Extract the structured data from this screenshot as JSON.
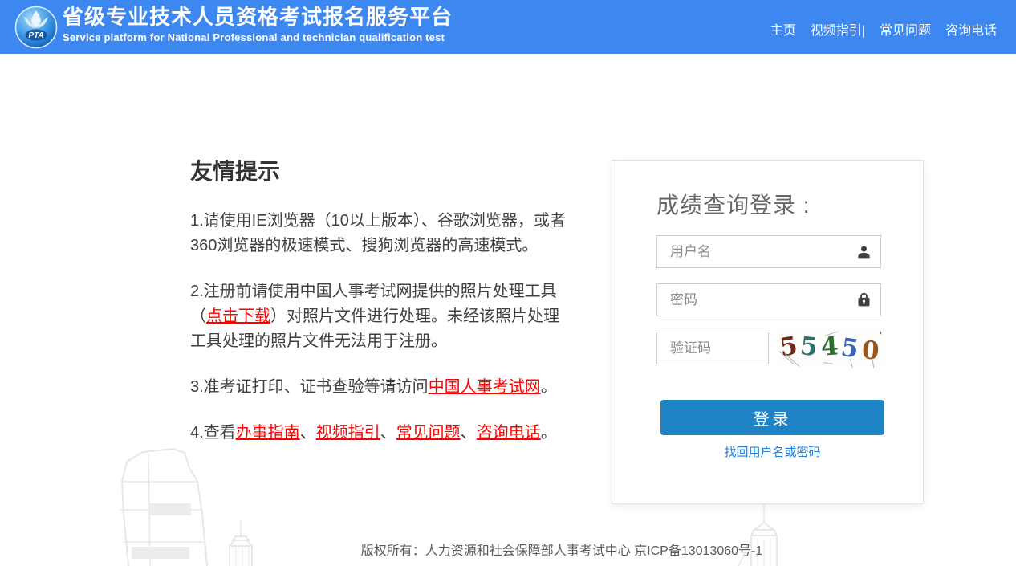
{
  "colors": {
    "header_bg": "#3d87f1",
    "login_button_bg": "#1e83c5",
    "red_link": "#fe0000",
    "blue_link": "#1b82e3"
  },
  "header": {
    "logo_text": "PTA",
    "title": "省级专业技术人员资格考试报名服务平台",
    "subtitle": "Service platform for National Professional and technician qualification test",
    "nav": [
      {
        "label": "主页"
      },
      {
        "label": "视频指引|"
      },
      {
        "label": "常见问题"
      },
      {
        "label": "咨询电话"
      }
    ]
  },
  "tips": {
    "heading": "友情提示",
    "p1": {
      "t0": "1.请使用IE浏览器（10以上版本）、谷歌浏览器，或者360浏览器的极速模式、搜狗浏览器的高速模式。"
    },
    "p2": {
      "t0": "2.注册前请使用中国人事考试网提供的照片处理工具（",
      "link1": "点击下载",
      "t2": "）对照片文件进行处理。未经该照片处理工具处理的照片文件无法用于注册。"
    },
    "p3": {
      "t0": "3.准考证打印、证书查验等请访问",
      "link1": "中国人事考试网",
      "t2": "。"
    },
    "p4": {
      "t0": "4.查看",
      "link1": "办事指南",
      "t2": "、",
      "link3": "视频指引",
      "t4": "、",
      "link5": "常见问题",
      "t6": "、",
      "link7": "咨询电话",
      "t8": "。"
    }
  },
  "login": {
    "title": "成绩查询登录 :",
    "username_placeholder": "用户名",
    "password_placeholder": "密码",
    "captcha_placeholder": "验证码",
    "captcha": {
      "code": "55450",
      "digits": [
        {
          "char": "5",
          "color": "#6f2a1b"
        },
        {
          "char": "5",
          "color": "#2f6e69"
        },
        {
          "char": "4",
          "color": "#2e6e2f"
        },
        {
          "char": "5",
          "color": "#3b63c0"
        },
        {
          "char": "0",
          "color": "#95571d"
        }
      ]
    },
    "login_label": "登录",
    "forgot_label": "找回用户名或密码"
  },
  "footer": {
    "copyright": "版权所有：人力资源和社会保障部人事考试中心 京ICP备13013060号-1"
  }
}
